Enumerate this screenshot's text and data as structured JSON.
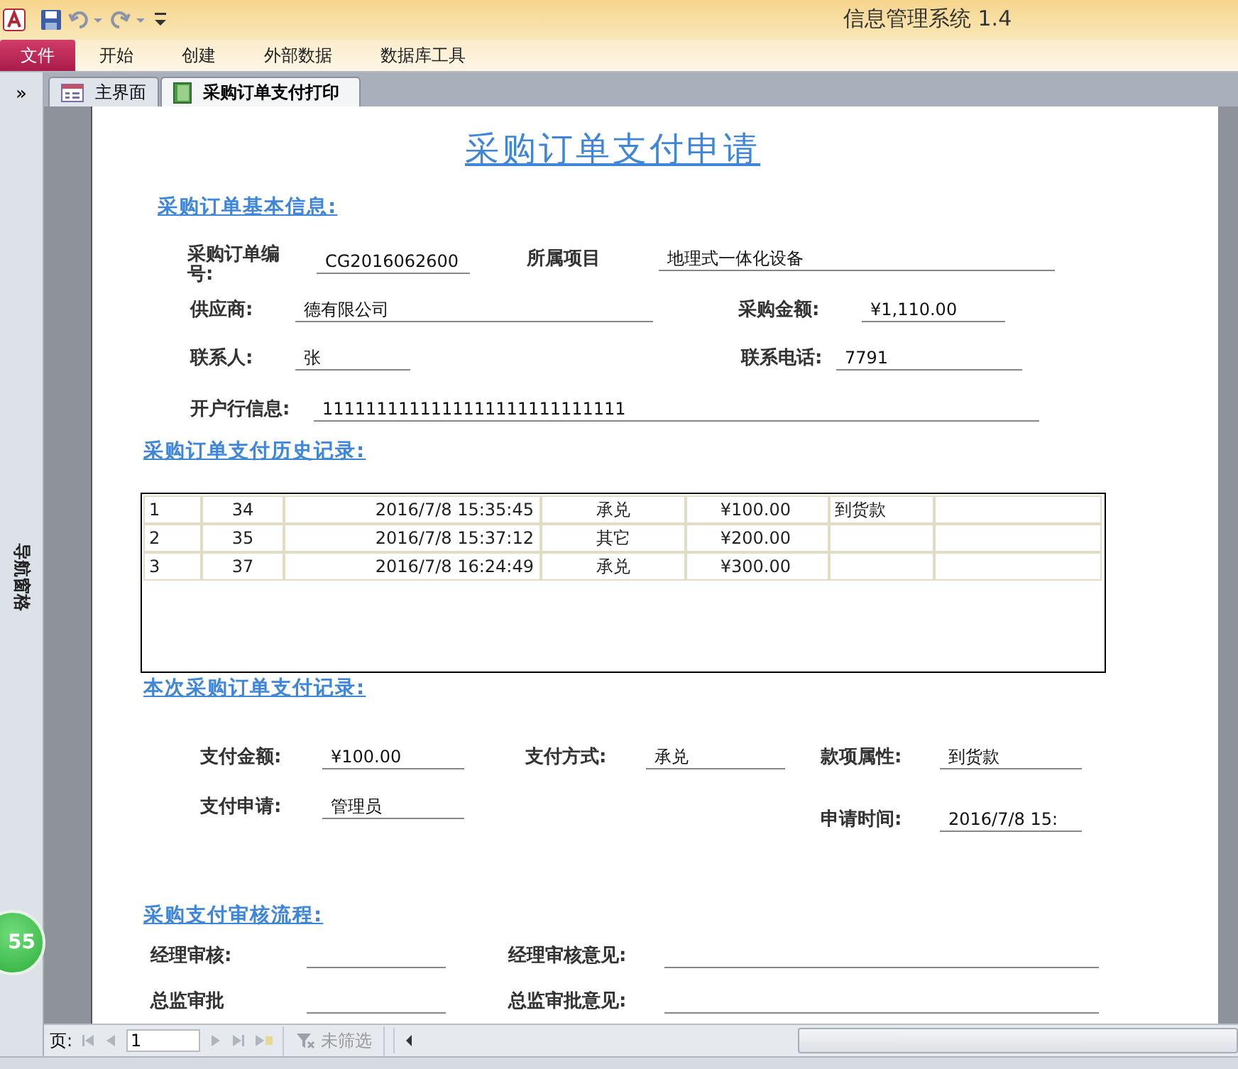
{
  "window": {
    "title": "信息管理系统 1.4"
  },
  "ribbon_tabs": [
    {
      "label": "文件",
      "kind": "file",
      "selected": false
    },
    {
      "label": "开始",
      "kind": "tab",
      "selected": false
    },
    {
      "label": "创建",
      "kind": "tab",
      "selected": false
    },
    {
      "label": "外部数据",
      "kind": "tab",
      "selected": false
    },
    {
      "label": "数据库工具",
      "kind": "tab",
      "selected": false
    }
  ],
  "nav_pane": {
    "toggle": "»",
    "title": "导航窗格"
  },
  "document_tabs": [
    {
      "label": "主界面",
      "kind": "form",
      "selected": false
    },
    {
      "label": "采购订单支付打印",
      "kind": "report",
      "selected": true
    }
  ],
  "report": {
    "title": "采购订单支付申请",
    "basic_info": {
      "heading": "采购订单基本信息:",
      "rows": [
        [
          {
            "label": "采购订单编号:",
            "value": "CG2016062600"
          },
          {
            "label": "所属项目",
            "value": "地理式一体化设备"
          }
        ],
        [
          {
            "label": "供应商:",
            "value": "德有限公司"
          },
          {
            "label": "采购金额:",
            "value": "¥1,110.00"
          }
        ],
        [
          {
            "label": "联系人:",
            "value": "张"
          },
          {
            "label": "联系电话:",
            "value": "7791"
          }
        ],
        [
          {
            "label": "开户行信息:",
            "value": "1111111111111111111111111111"
          }
        ]
      ]
    },
    "history": {
      "heading": "采购订单支付历史记录:",
      "rows": [
        [
          "1",
          "34",
          "2016/7/8  15:35:45",
          "承兑",
          "¥100.00",
          "到货款",
          null
        ],
        [
          "2",
          "35",
          "2016/7/8  15:37:12",
          "其它",
          "¥200.00",
          null,
          null
        ],
        [
          "3",
          "37",
          "2016/7/8  16:24:49",
          "承兑",
          "¥300.00",
          null,
          null
        ]
      ]
    },
    "current": {
      "heading": "本次采购订单支付记录:",
      "rows": [
        [
          {
            "label": "支付金额:",
            "value": "¥100.00"
          },
          {
            "label": "支付方式:",
            "value": "承兑"
          },
          {
            "label": "款项属性:",
            "value": "到货款"
          }
        ],
        [
          {
            "label": "支付申请:",
            "value": "管理员"
          },
          null,
          {
            "label": "申请时间:",
            "value": "2016/7/8 15:"
          }
        ]
      ]
    },
    "approval": {
      "heading": "采购支付审核流程:",
      "rows": [
        [
          {
            "label": "经理审核:"
          },
          {
            "label": "经理审核意见:"
          }
        ],
        [
          {
            "label": "总监审批"
          },
          {
            "label": "总监审批意见:"
          }
        ]
      ]
    }
  },
  "record_nav": {
    "label": "页:",
    "page": "1",
    "filter": "未筛选"
  },
  "badge": "55"
}
